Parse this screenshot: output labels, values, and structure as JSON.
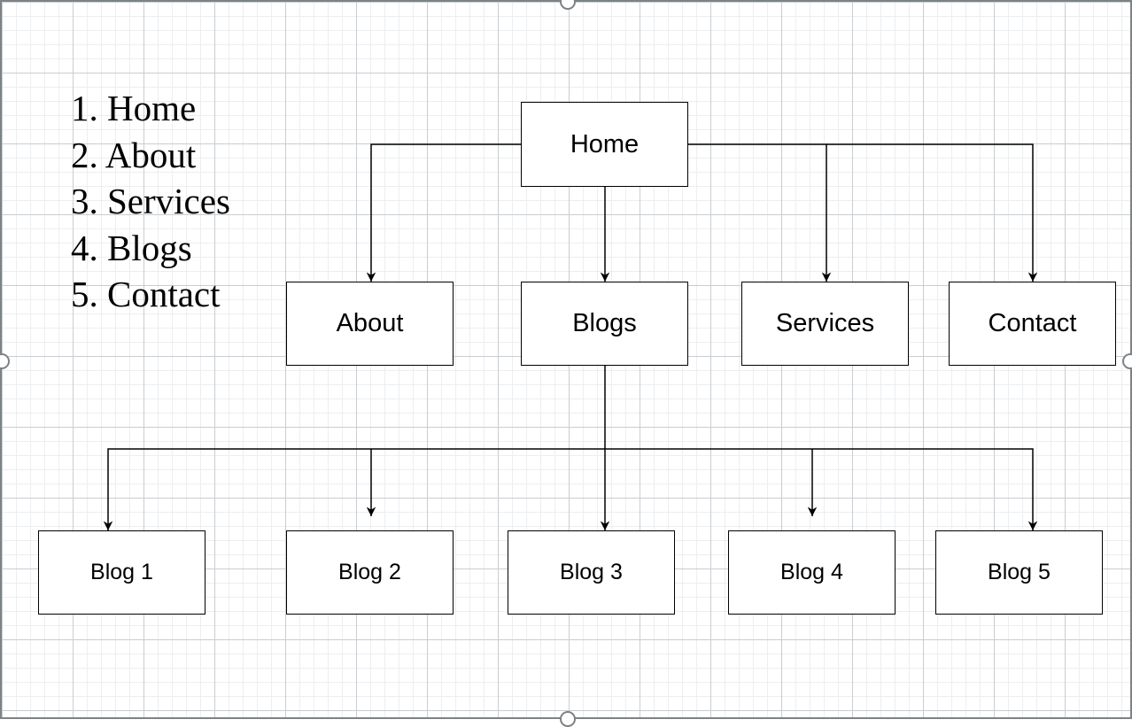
{
  "outline": [
    "1. Home",
    "2. About",
    "3. Services",
    "4. Blogs",
    "5. Contact"
  ],
  "nodes": {
    "home": "Home",
    "about": "About",
    "blogs": "Blogs",
    "services": "Services",
    "contact": "Contact",
    "blog1": "Blog 1",
    "blog2": "Blog 2",
    "blog3": "Blog 3",
    "blog4": "Blog 4",
    "blog5": "Blog 5"
  },
  "edges": [
    {
      "from": "home",
      "to": "about"
    },
    {
      "from": "home",
      "to": "blogs"
    },
    {
      "from": "home",
      "to": "services"
    },
    {
      "from": "home",
      "to": "contact"
    },
    {
      "from": "blogs",
      "to": "blog1"
    },
    {
      "from": "blogs",
      "to": "blog2"
    },
    {
      "from": "blogs",
      "to": "blog3"
    },
    {
      "from": "blogs",
      "to": "blog4"
    },
    {
      "from": "blogs",
      "to": "blog5"
    }
  ],
  "colors": {
    "line": "#000000",
    "node_fill": "#ffffff",
    "grid": "#c9cdd1",
    "selection_border": "#7d8285"
  }
}
